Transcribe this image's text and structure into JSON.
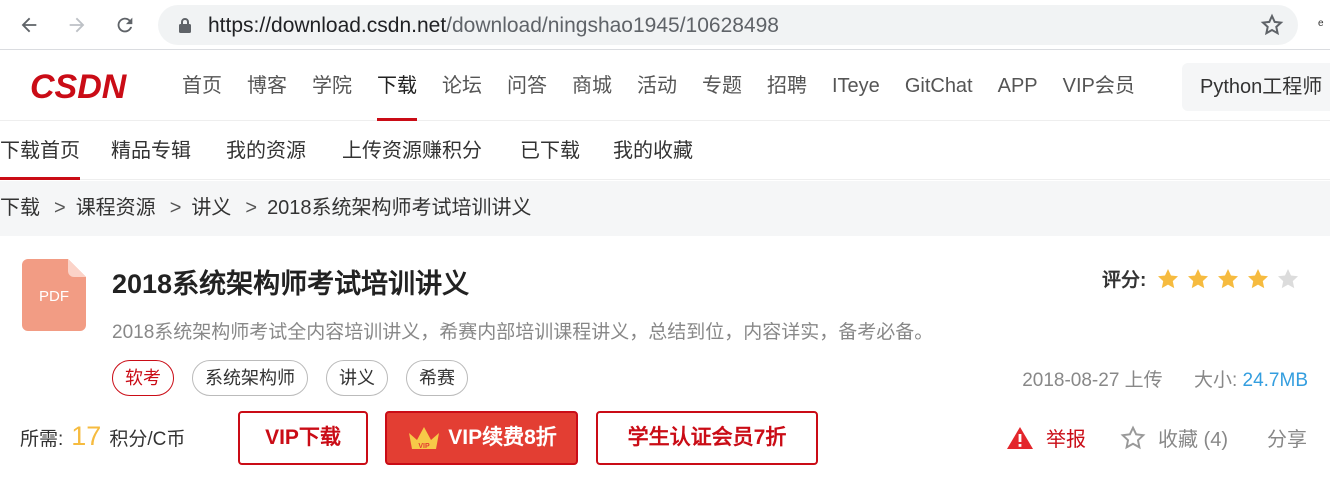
{
  "browser": {
    "url_host": "https://download.csdn.net",
    "url_path": "/download/ningshao1945/10628498"
  },
  "topnav": {
    "logo_text": "CSDN",
    "items": [
      {
        "label": "首页"
      },
      {
        "label": "博客"
      },
      {
        "label": "学院"
      },
      {
        "label": "下载",
        "active": true
      },
      {
        "label": "论坛"
      },
      {
        "label": "问答"
      },
      {
        "label": "商城"
      },
      {
        "label": "活动"
      },
      {
        "label": "专题"
      },
      {
        "label": "招聘"
      },
      {
        "label": "ITeye"
      },
      {
        "label": "GitChat"
      },
      {
        "label": "APP"
      },
      {
        "label": "VIP会员"
      }
    ],
    "search_value": "Python工程师"
  },
  "subnav": {
    "items": [
      "下载首页",
      "精品专辑",
      "我的资源",
      "上传资源赚积分",
      "已下载",
      "我的收藏"
    ]
  },
  "breadcrumb": [
    "下载",
    "课程资源",
    "讲义",
    "2018系统架构师考试培训讲义"
  ],
  "resource": {
    "file_type": "PDF",
    "title": "2018系统架构师考试培训讲义",
    "rating_label": "评分:",
    "rating": 4,
    "rating_max": 5,
    "description": "2018系统架构师考试全内容培训讲义，希赛内部培训课程讲义，总结到位，内容详实，备考必备。",
    "tags": [
      "软考",
      "系统架构师",
      "讲义",
      "希赛"
    ],
    "upload_date": "2018-08-27 上传",
    "size_label": "大小:",
    "size_value": "24.7MB",
    "cost_label": "所需:",
    "cost_value": "17",
    "cost_unit": "积分/C币"
  },
  "buttons": {
    "vip_download": "VIP下载",
    "vip_renew": "VIP续费8折",
    "student": "学生认证会员7折"
  },
  "actions": {
    "report": "举报",
    "collect": "收藏 (4)",
    "share": "分享"
  },
  "colors": {
    "brand_red": "#ca0c16",
    "star_gold": "#f6bb3f",
    "size_blue": "#349edf"
  }
}
